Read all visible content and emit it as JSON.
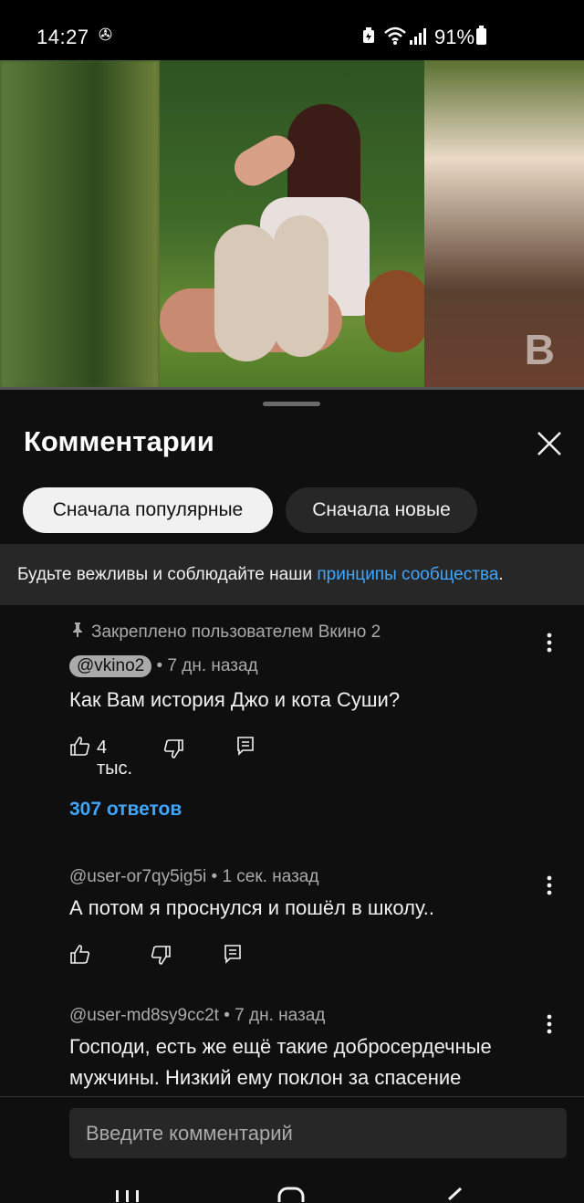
{
  "status_bar": {
    "time": "14:27",
    "battery_percent": "91%",
    "icons": [
      "pinwheel-icon",
      "battery-saver-icon",
      "wifi-icon",
      "signal-icon",
      "battery-icon"
    ]
  },
  "video": {
    "watermark": "B"
  },
  "sheet": {
    "title": "Комментарии",
    "sort_chips": [
      {
        "label": "Сначала популярные",
        "active": true
      },
      {
        "label": "Сначала новые",
        "active": false
      }
    ],
    "notice": {
      "text": "Будьте вежливы и соблюдайте наши ",
      "link": "принципы сообщества",
      "suffix": "."
    }
  },
  "comments": [
    {
      "pinned_label": "Закреплено пользователем Вкино 2",
      "author": "@vkino2",
      "time": "• 7 дн. назад",
      "text": "Как Вам история Джо и кота Суши?",
      "likes": "4 тыс.",
      "replies": "307 ответов"
    },
    {
      "author": "@user-or7qy5ig5i",
      "time": "• 1 сек. назад",
      "text": "А потом я проснулся и пошёл в школу.."
    },
    {
      "author": "@user-md8sy9cc2t",
      "time": "• 7 дн. назад",
      "text": "Господи, есть же ещё такие добросердечные мужчины. Низкий ему поклон за спасение"
    }
  ],
  "compose": {
    "placeholder": "Введите комментарий"
  },
  "colors": {
    "background": "#0f0f0f",
    "chip_active": "#f1f1f1",
    "chip_inactive": "#272727",
    "link": "#3ea6ff",
    "secondary_text": "#aaaaaa"
  }
}
